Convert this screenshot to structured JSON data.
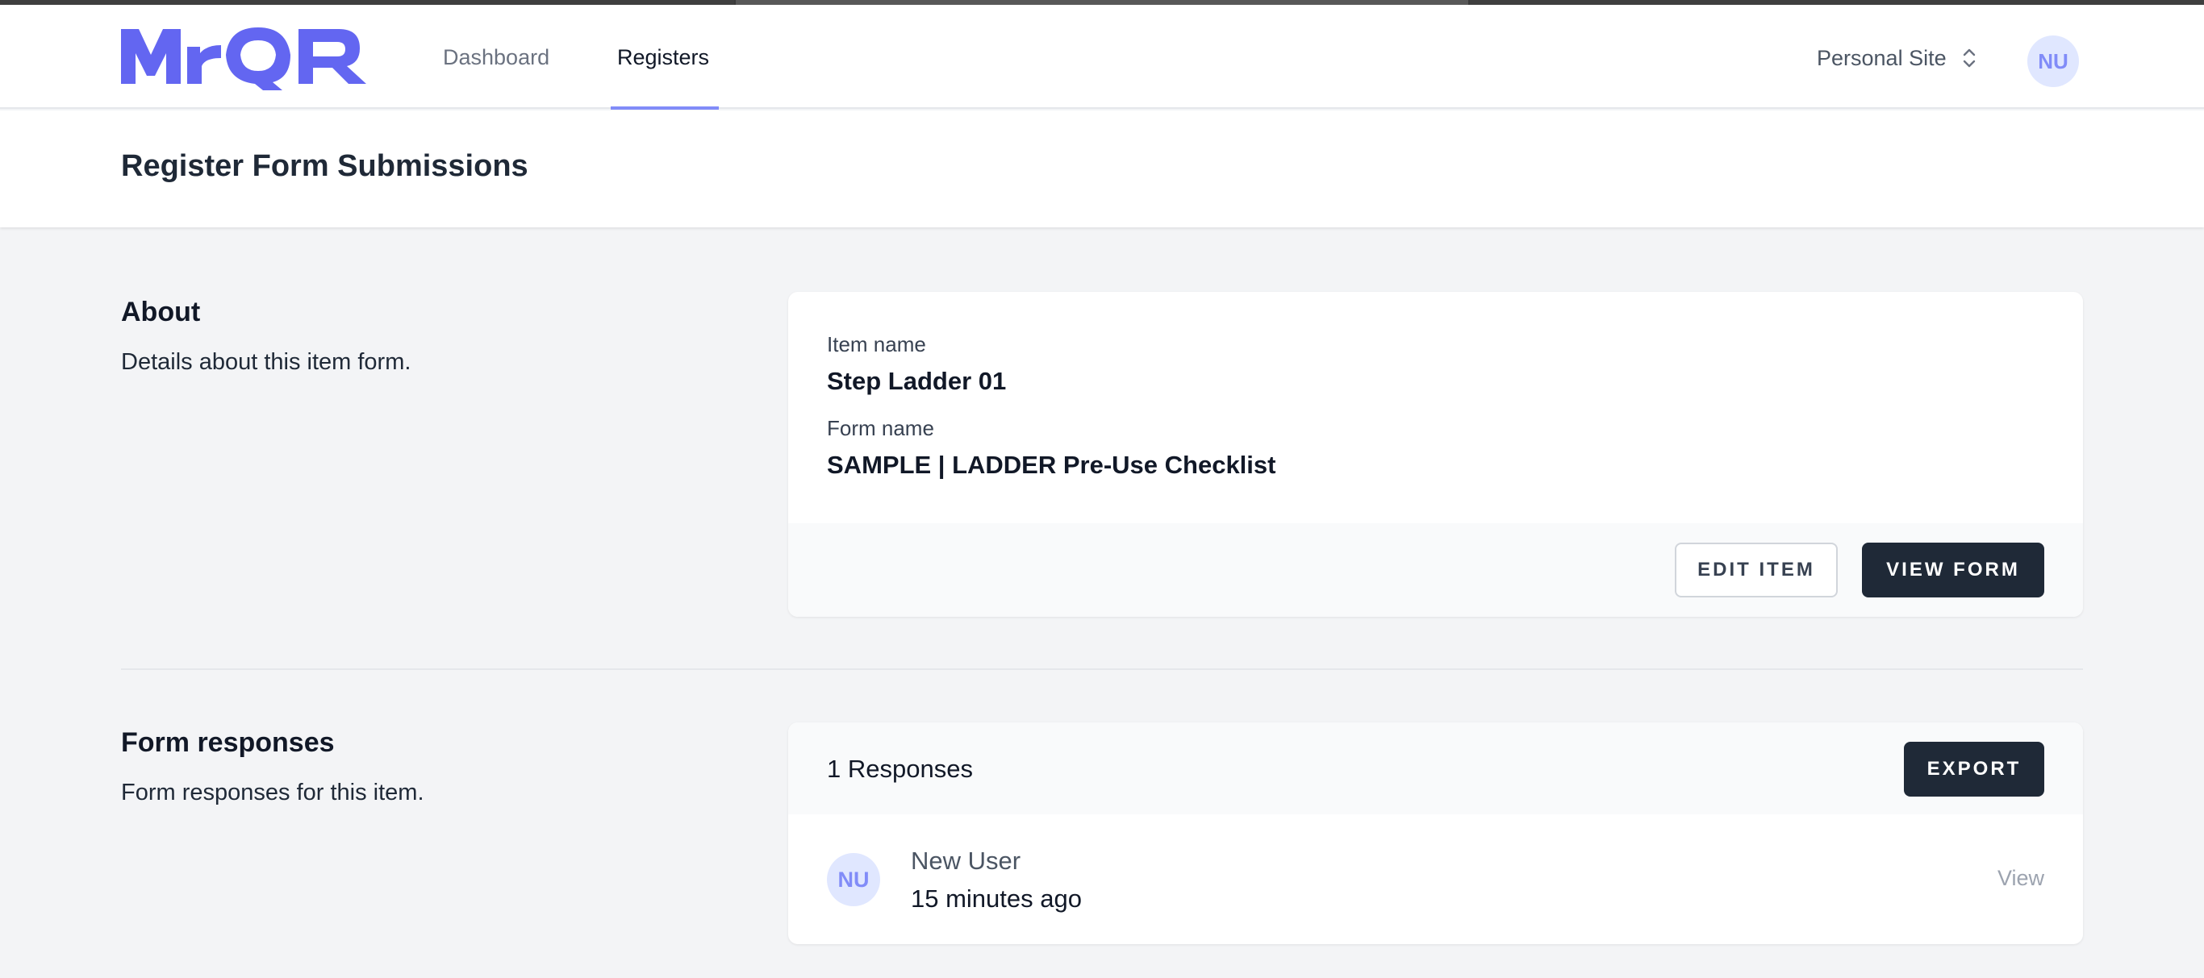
{
  "app": {
    "logo_text": "MrQR",
    "brand_color": "#6366f1"
  },
  "nav": {
    "links": [
      {
        "label": "Dashboard",
        "active": false
      },
      {
        "label": "Registers",
        "active": true
      }
    ],
    "site_switcher": {
      "label": "Personal Site",
      "icon": "chevron-up-down-icon"
    },
    "user_initials": "NU"
  },
  "page": {
    "title": "Register Form Submissions"
  },
  "about": {
    "title": "About",
    "description": "Details about this item form.",
    "item_name_label": "Item name",
    "item_name_value": "Step Ladder 01",
    "form_name_label": "Form name",
    "form_name_value": "SAMPLE | LADDER Pre-Use Checklist",
    "edit_button": "EDIT ITEM",
    "view_button": "VIEW FORM"
  },
  "responses": {
    "title": "Form responses",
    "description": "Form responses for this item.",
    "count_label": "1 Responses",
    "export_button": "EXPORT",
    "items": [
      {
        "initials": "NU",
        "user": "New User",
        "time": "15 minutes ago",
        "action": "View"
      }
    ]
  }
}
